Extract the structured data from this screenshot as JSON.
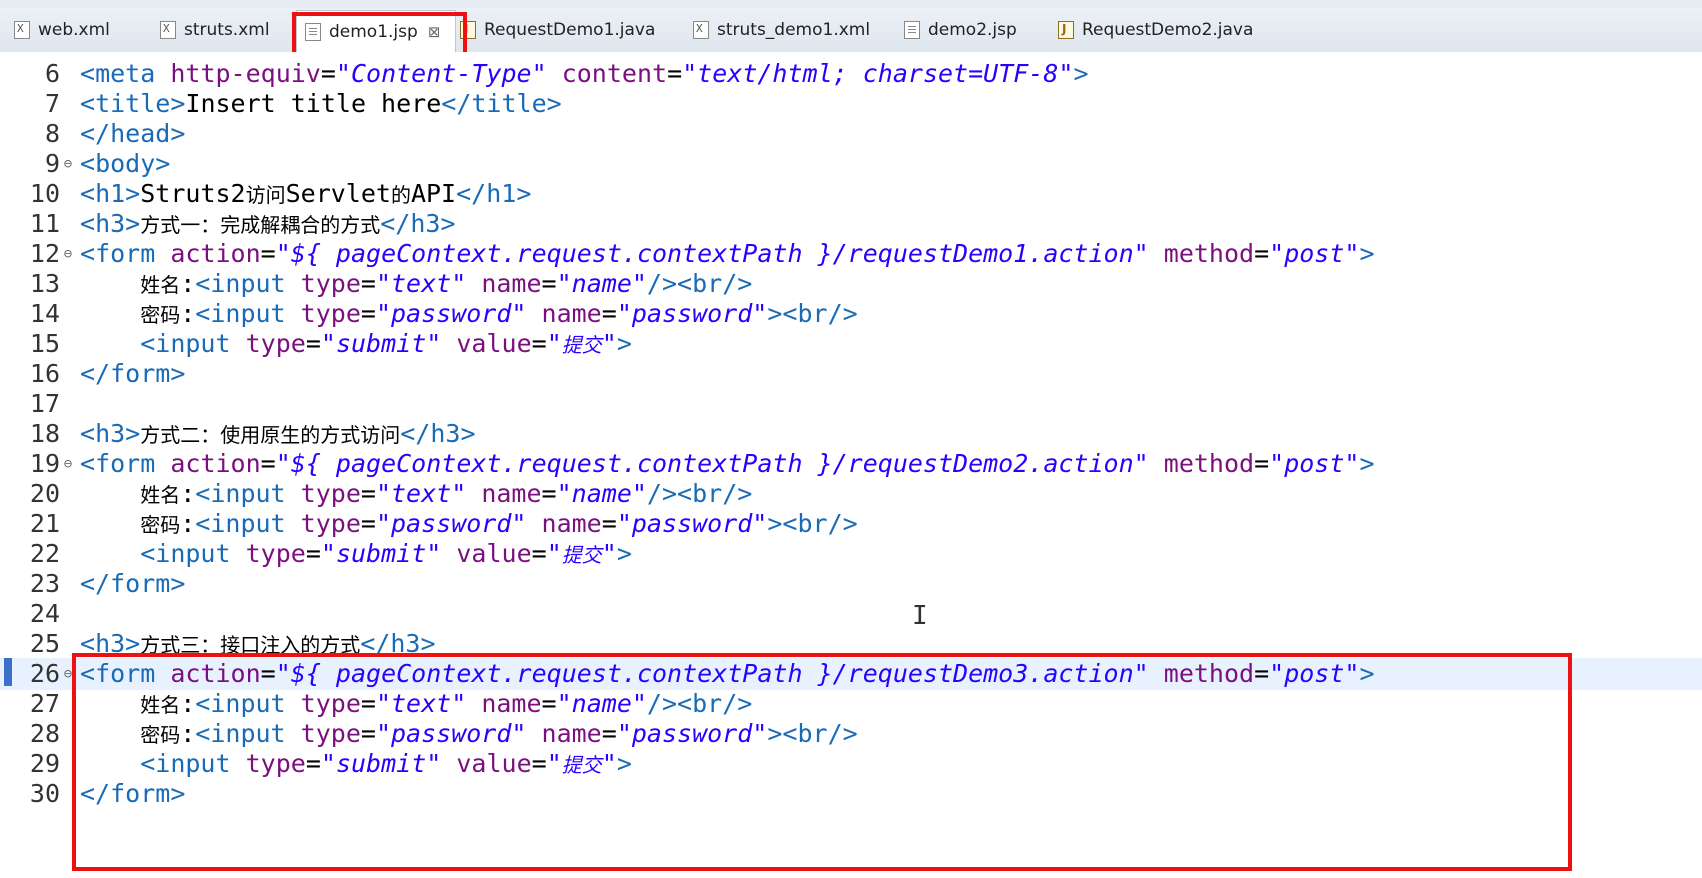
{
  "tabs": [
    {
      "label": "web.xml",
      "icon": "xml-file-icon",
      "active": false
    },
    {
      "label": "struts.xml",
      "icon": "xml-file-icon",
      "active": false
    },
    {
      "label": "demo1.jsp",
      "icon": "jsp-file-icon",
      "active": true,
      "close": "⊠"
    },
    {
      "label": "RequestDemo1.java",
      "icon": "java-file-icon",
      "active": false
    },
    {
      "label": "struts_demo1.xml",
      "icon": "xml-file-icon",
      "active": false
    },
    {
      "label": "demo2.jsp",
      "icon": "jsp-file-icon",
      "active": false
    },
    {
      "label": "RequestDemo2.java",
      "icon": "java-file-icon",
      "active": false
    }
  ],
  "lines": [
    {
      "n": "6",
      "text": "<meta http-equiv=\"Content-Type\" content=\"text/html; charset=UTF-8\">"
    },
    {
      "n": "7",
      "text": "<title>Insert title here</title>"
    },
    {
      "n": "8",
      "text": "</head>"
    },
    {
      "n": "9",
      "text": "<body>"
    },
    {
      "n": "10",
      "text": "<h1>Struts2访问Servlet的API</h1>"
    },
    {
      "n": "11",
      "text": "<h3>方式一：完成解耦合的方式</h3>"
    },
    {
      "n": "12",
      "text": "<form action=\"${ pageContext.request.contextPath }/requestDemo1.action\" method=\"post\">"
    },
    {
      "n": "13",
      "text": "    姓名:<input type=\"text\" name=\"name\"/><br/>"
    },
    {
      "n": "14",
      "text": "    密码:<input type=\"password\" name=\"password\"><br/>"
    },
    {
      "n": "15",
      "text": "    <input type=\"submit\" value=\"提交\">"
    },
    {
      "n": "16",
      "text": "</form>"
    },
    {
      "n": "17",
      "text": ""
    },
    {
      "n": "18",
      "text": "<h3>方式二：使用原生的方式访问</h3>"
    },
    {
      "n": "19",
      "text": "<form action=\"${ pageContext.request.contextPath }/requestDemo2.action\" method=\"post\">"
    },
    {
      "n": "20",
      "text": "    姓名:<input type=\"text\" name=\"name\"/><br/>"
    },
    {
      "n": "21",
      "text": "    密码:<input type=\"password\" name=\"password\"><br/>"
    },
    {
      "n": "22",
      "text": "    <input type=\"submit\" value=\"提交\">"
    },
    {
      "n": "23",
      "text": "</form>"
    },
    {
      "n": "24",
      "text": ""
    },
    {
      "n": "25",
      "text": "<h3>方式三：接口注入的方式</h3>"
    },
    {
      "n": "26",
      "text": "<form action=\"${ pageContext.request.contextPath }/requestDemo3.action\" method=\"post\">"
    },
    {
      "n": "27",
      "text": "    姓名:<input type=\"text\" name=\"name\"/><br/>"
    },
    {
      "n": "28",
      "text": "    密码:<input type=\"password\" name=\"password\"><br/>"
    },
    {
      "n": "29",
      "text": "    <input type=\"submit\" value=\"提交\">"
    },
    {
      "n": "30",
      "text": "</form>"
    }
  ],
  "colors": {
    "tag": "#196bb6",
    "attr": "#7a0f7f",
    "string": "#2a00ff",
    "highlight": "#ee1111",
    "current_line": "#e8f2fe"
  }
}
